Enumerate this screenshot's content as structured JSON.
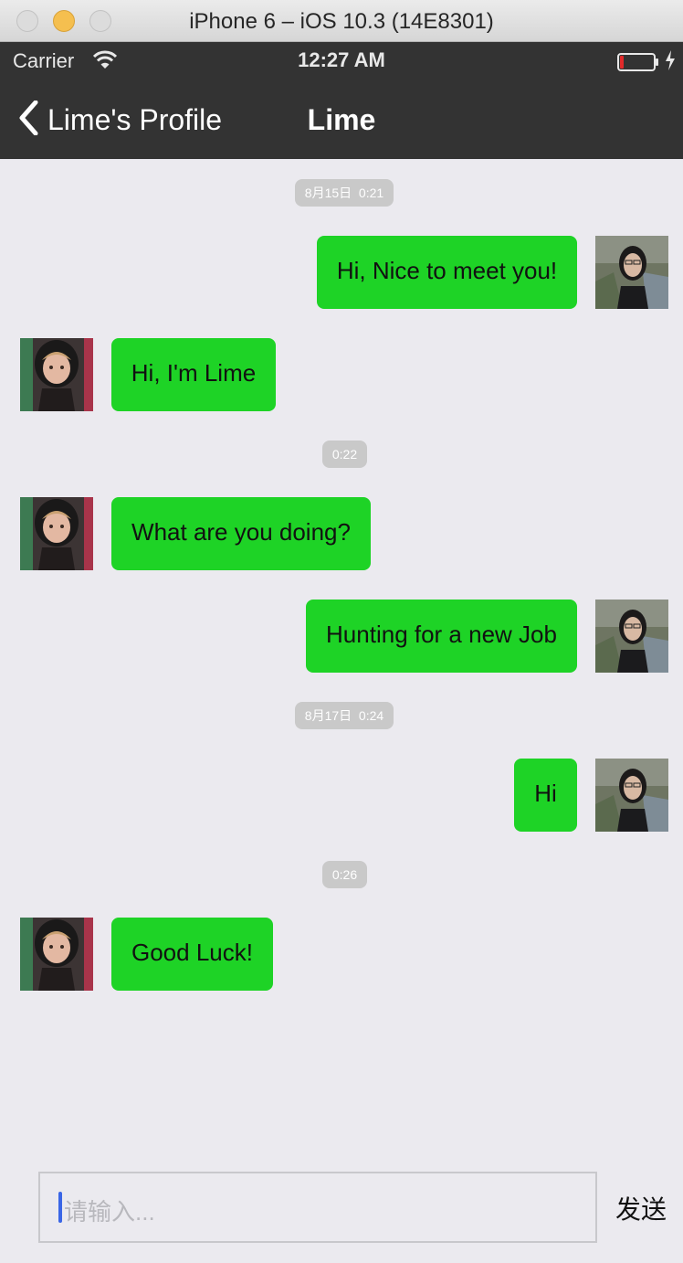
{
  "window": {
    "title": "iPhone 6 – iOS 10.3 (14E8301)"
  },
  "status_bar": {
    "carrier": "Carrier",
    "time": "12:27 AM",
    "battery_color": "#e22a2a"
  },
  "nav": {
    "back_label": "Lime's Profile",
    "title": "Lime"
  },
  "colors": {
    "bubble": "#1ed326",
    "chat_bg": "#ebeaef",
    "bar_bg": "#333333",
    "timestamp_bg": "#c9c9c9"
  },
  "messages": [
    {
      "type": "timestamp",
      "text": "8月15日  0:21"
    },
    {
      "type": "message",
      "side": "right",
      "sender": "me",
      "text": "Hi, Nice to meet you!"
    },
    {
      "type": "message",
      "side": "left",
      "sender": "Lime",
      "text": "Hi, I'm Lime"
    },
    {
      "type": "timestamp",
      "text": "0:22"
    },
    {
      "type": "message",
      "side": "left",
      "sender": "Lime",
      "text": "What are you doing?"
    },
    {
      "type": "message",
      "side": "right",
      "sender": "me",
      "text": "Hunting for a new Job"
    },
    {
      "type": "timestamp",
      "text": "8月17日  0:24"
    },
    {
      "type": "message",
      "side": "right",
      "sender": "me",
      "text": "Hi"
    },
    {
      "type": "timestamp",
      "text": "0:26"
    },
    {
      "type": "message",
      "side": "left",
      "sender": "Lime",
      "text": "Good Luck!"
    }
  ],
  "input": {
    "placeholder": "请输入...",
    "value": ""
  },
  "send_label": "发送"
}
